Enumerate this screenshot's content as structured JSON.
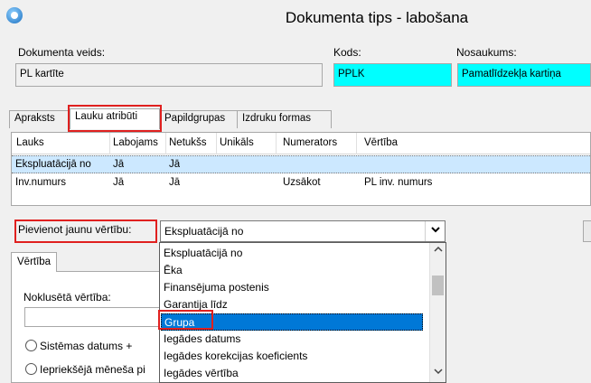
{
  "window": {
    "title": "Dokumenta tips - labošana"
  },
  "header": {
    "doc_type_label": "Dokumenta veids:",
    "doc_type_value": "PL kartīte",
    "code_label": "Kods:",
    "code_value": "PPLK",
    "name_label": "Nosaukums:",
    "name_value": "Pamatlīdzekļa kartiņa"
  },
  "tabs": [
    "Apraksts",
    "Lauku atribūti",
    "Papildgrupas",
    "Izdruku formas"
  ],
  "grid": {
    "columns": [
      "Lauks",
      "Labojams",
      "Netukšs",
      "Unikāls",
      "Numerators",
      "Vērtība"
    ],
    "rows": [
      [
        "Ekspluatācijā no",
        "Jā",
        "Jā",
        "",
        "",
        ""
      ],
      [
        "Inv.numurs",
        "Jā",
        "Jā",
        "",
        "Uzsākot",
        "PL inv. numurs"
      ]
    ]
  },
  "add_value": {
    "label": "Pievienot jaunu vērtību:",
    "selected": "Ekspluatācijā no",
    "options": [
      "Ekspluatācijā no",
      "Ēka",
      "Finansējuma postenis",
      "Garantija līdz",
      "Grupa",
      "Iegādes datums",
      "Iegādes korekcijas koeficients",
      "Iegādes vērtība"
    ],
    "highlighted_index": 4
  },
  "value_panel": {
    "tab_label": "Vērtība",
    "default_label": "Noklusētā vērtība:",
    "radio_system_date": "Sistēmas datums +",
    "radio_prev_month": "Iepriekšējā mēneša pi"
  },
  "icons": {
    "app": "app-logo-icon",
    "combo_arrow": "chevron-down-icon",
    "scroll_up": "chevron-up-icon",
    "scroll_down": "chevron-down-icon"
  },
  "colors": {
    "cyan_field": "#00ffff",
    "highlight": "#0078d7",
    "selected_row": "#cce8ff",
    "annotation_red": "#e0201f"
  }
}
